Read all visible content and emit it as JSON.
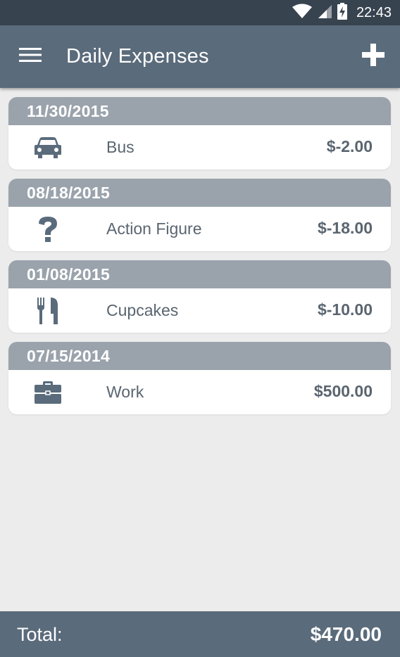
{
  "status_bar": {
    "time": "22:43",
    "icons": [
      "wifi-icon",
      "signal-icon",
      "battery-charging-icon"
    ]
  },
  "app_bar": {
    "title": "Daily Expenses",
    "menu_icon": "menu-icon",
    "add_icon": "plus-icon"
  },
  "expenses": [
    {
      "date": "11/30/2015",
      "icon": "car-icon",
      "label": "Bus",
      "amount": "$-2.00"
    },
    {
      "date": "08/18/2015",
      "icon": "question-icon",
      "label": "Action Figure",
      "amount": "$-18.00"
    },
    {
      "date": "01/08/2015",
      "icon": "fork-knife-icon",
      "label": "Cupcakes",
      "amount": "$-10.00"
    },
    {
      "date": "07/15/2014",
      "icon": "briefcase-icon",
      "label": "Work",
      "amount": "$500.00"
    }
  ],
  "footer": {
    "label": "Total:",
    "total": "$470.00"
  },
  "colors": {
    "status_bar": "#37434f",
    "app_bar": "#5a6b7b",
    "card_header": "#9aa3ac",
    "background": "#ececec",
    "icon": "#5a6b7b",
    "text": "#5a6570"
  }
}
